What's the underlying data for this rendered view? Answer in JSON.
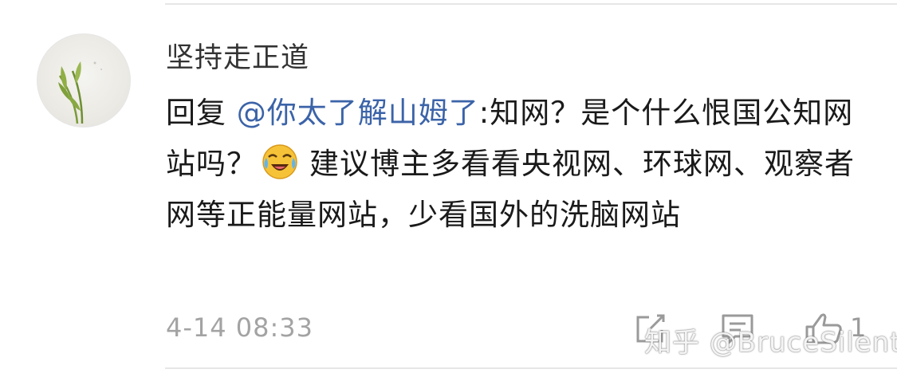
{
  "comment": {
    "username": "坚持走正道",
    "reply_prefix": "回复 ",
    "mention": "@你太了解山姆了",
    "text_before_emoji": ":知网？是个什么恨国公知网站吗？",
    "emoji_icon": "crying-laughing-emoji-icon",
    "text_after_emoji": "建议博主多看看央视网、环球网、观察者网等正能量网站，少看国外的洗脑网站",
    "timestamp": "4-14 08:33"
  },
  "actions": {
    "share_icon": "share-icon",
    "comment_icon": "comment-icon",
    "like_icon": "thumbs-up-icon",
    "like_count": "1"
  },
  "watermark": {
    "text": "知乎 @BruceSilent"
  },
  "colors": {
    "mention": "#3b63a8",
    "text": "#1a1a1a",
    "muted": "#a3a3a3",
    "divider": "#e6e6e6"
  }
}
